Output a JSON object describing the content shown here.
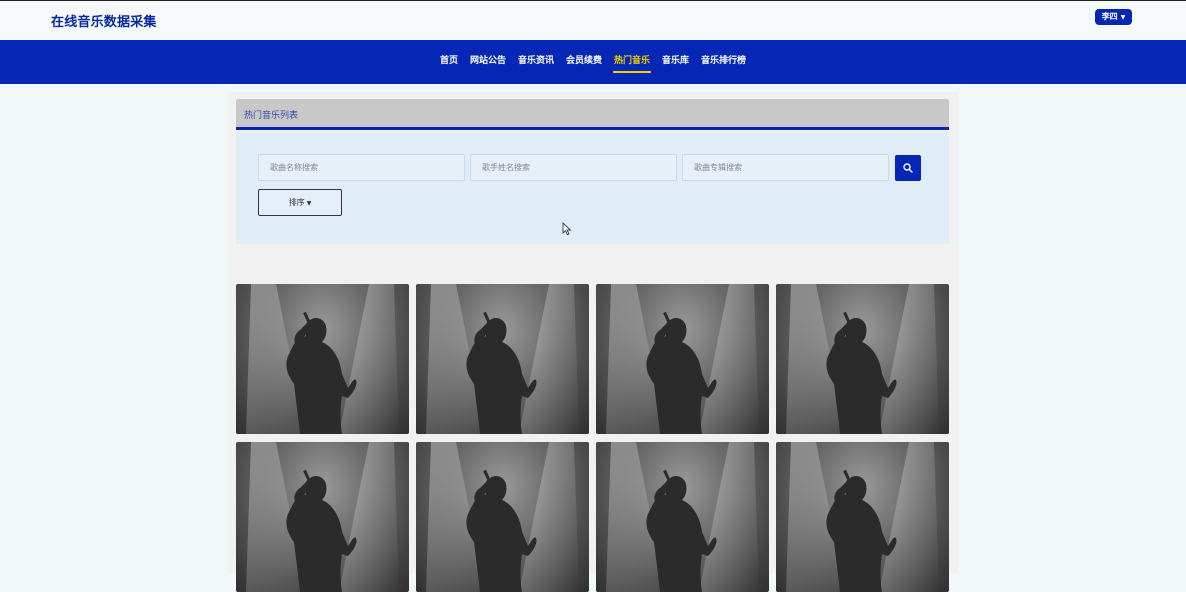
{
  "header": {
    "site_title": "在线音乐数据采集",
    "user_button": "李四"
  },
  "nav": {
    "items": [
      "首页",
      "网站公告",
      "音乐资讯",
      "会员续费",
      "热门音乐",
      "音乐库",
      "音乐排行榜"
    ],
    "active_index": 4
  },
  "panel": {
    "title": "热门音乐列表"
  },
  "search": {
    "song_placeholder": "歌曲名称搜索",
    "singer_placeholder": "歌手姓名搜索",
    "album_placeholder": "歌曲专辑搜索",
    "sort_label": "排序"
  },
  "icons": {
    "search": "search-icon",
    "user_caret": "caret-down-icon",
    "sort_caret": "caret-down-icon",
    "cursor": "mouse-pointer-icon",
    "card_image": "singer-silhouette-image"
  },
  "cards_count": 8,
  "colors": {
    "brand_blue": "#0527b3",
    "active_nav": "#f4d000",
    "title_blue": "#0a2a9e",
    "search_bg": "#e1ecf9",
    "panel_header_bg": "#c8c8c8"
  }
}
